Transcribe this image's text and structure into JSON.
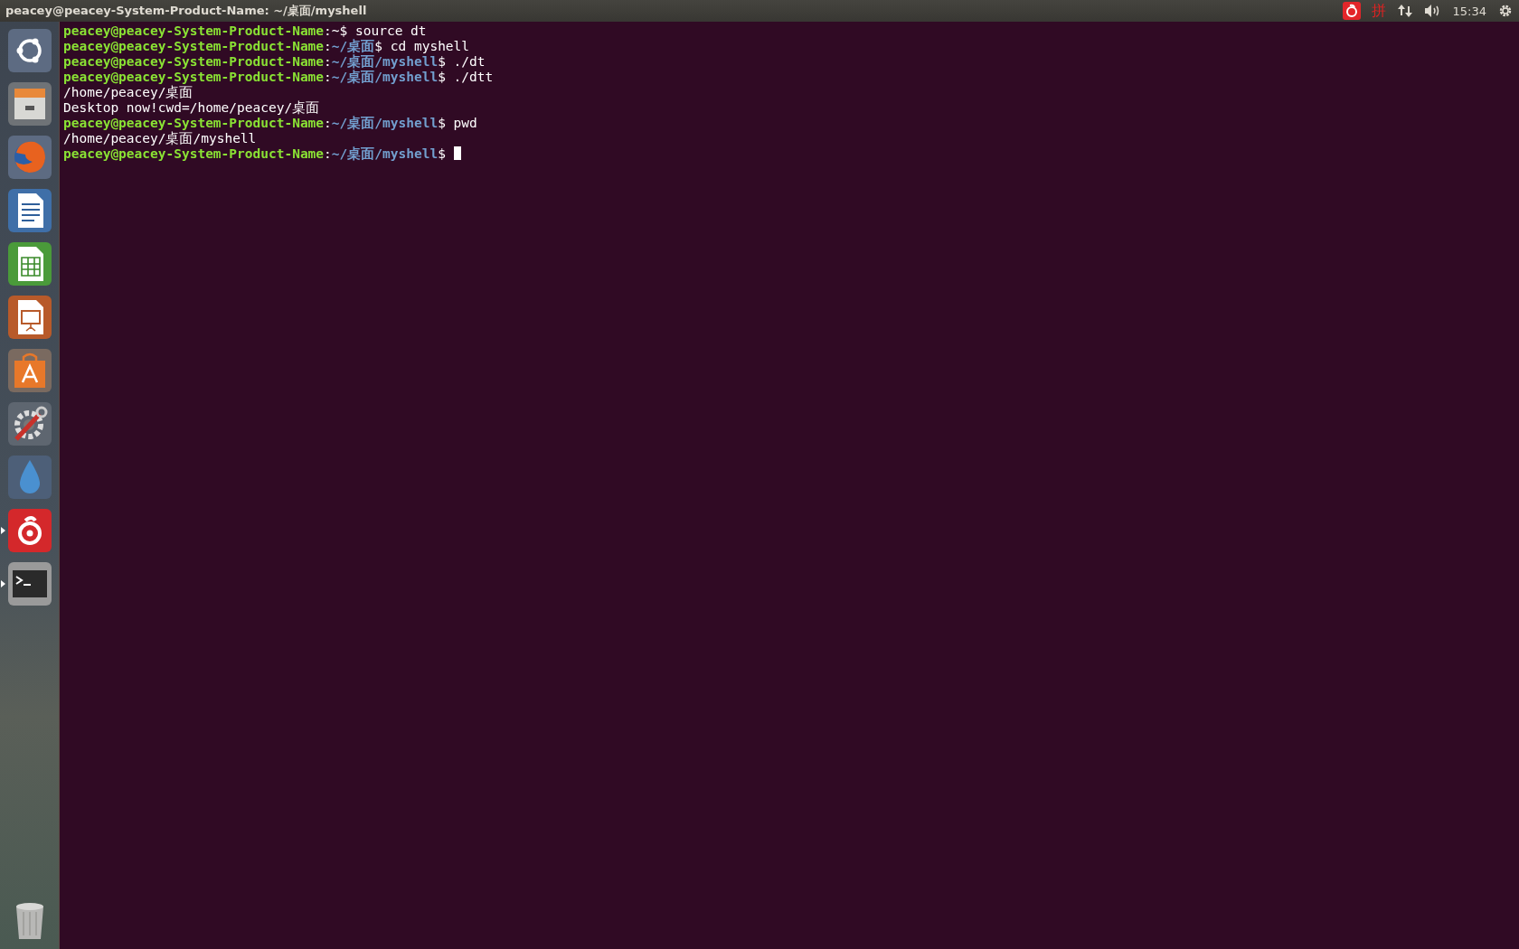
{
  "top_bar": {
    "title": "peacey@peacey-System-Product-Name: ~/桌面/myshell",
    "input_method": "拼",
    "clock": "15:34"
  },
  "launcher": [
    {
      "kind": "dash",
      "running": false
    },
    {
      "kind": "files",
      "running": false
    },
    {
      "kind": "browser",
      "running": false
    },
    {
      "kind": "document",
      "running": false
    },
    {
      "kind": "spreadsheet",
      "running": false
    },
    {
      "kind": "presentation",
      "running": false
    },
    {
      "kind": "store",
      "running": false
    },
    {
      "kind": "settings",
      "running": false
    },
    {
      "kind": "drop",
      "running": false
    },
    {
      "kind": "music",
      "running": true
    },
    {
      "kind": "terminal",
      "running": true
    },
    {
      "kind": "trash",
      "running": false
    }
  ],
  "terminal": {
    "lines": [
      [
        {
          "kind": "user",
          "text": "peacey@peacey-System-Product-Name"
        },
        {
          "kind": "plain",
          "text": ":~$ source dt"
        }
      ],
      [
        {
          "kind": "user",
          "text": "peacey@peacey-System-Product-Name"
        },
        {
          "kind": "plain",
          "text": ":"
        },
        {
          "kind": "path",
          "text": "~/桌面"
        },
        {
          "kind": "plain",
          "text": "$ cd myshell"
        }
      ],
      [
        {
          "kind": "user",
          "text": "peacey@peacey-System-Product-Name"
        },
        {
          "kind": "plain",
          "text": ":"
        },
        {
          "kind": "path",
          "text": "~/桌面/myshell"
        },
        {
          "kind": "plain",
          "text": "$ ./dt"
        }
      ],
      [
        {
          "kind": "user",
          "text": "peacey@peacey-System-Product-Name"
        },
        {
          "kind": "plain",
          "text": ":"
        },
        {
          "kind": "path",
          "text": "~/桌面/myshell"
        },
        {
          "kind": "plain",
          "text": "$ ./dtt"
        }
      ],
      [
        {
          "kind": "plain",
          "text": "/home/peacey/桌面"
        }
      ],
      [
        {
          "kind": "plain",
          "text": "Desktop now!cwd=/home/peacey/桌面"
        }
      ],
      [
        {
          "kind": "user",
          "text": "peacey@peacey-System-Product-Name"
        },
        {
          "kind": "plain",
          "text": ":"
        },
        {
          "kind": "path",
          "text": "~/桌面/myshell"
        },
        {
          "kind": "plain",
          "text": "$ pwd"
        }
      ],
      [
        {
          "kind": "plain",
          "text": "/home/peacey/桌面/myshell"
        }
      ],
      [
        {
          "kind": "user",
          "text": "peacey@peacey-System-Product-Name"
        },
        {
          "kind": "plain",
          "text": ":"
        },
        {
          "kind": "path",
          "text": "~/桌面/myshell"
        },
        {
          "kind": "plain",
          "text": "$ "
        }
      ]
    ]
  }
}
